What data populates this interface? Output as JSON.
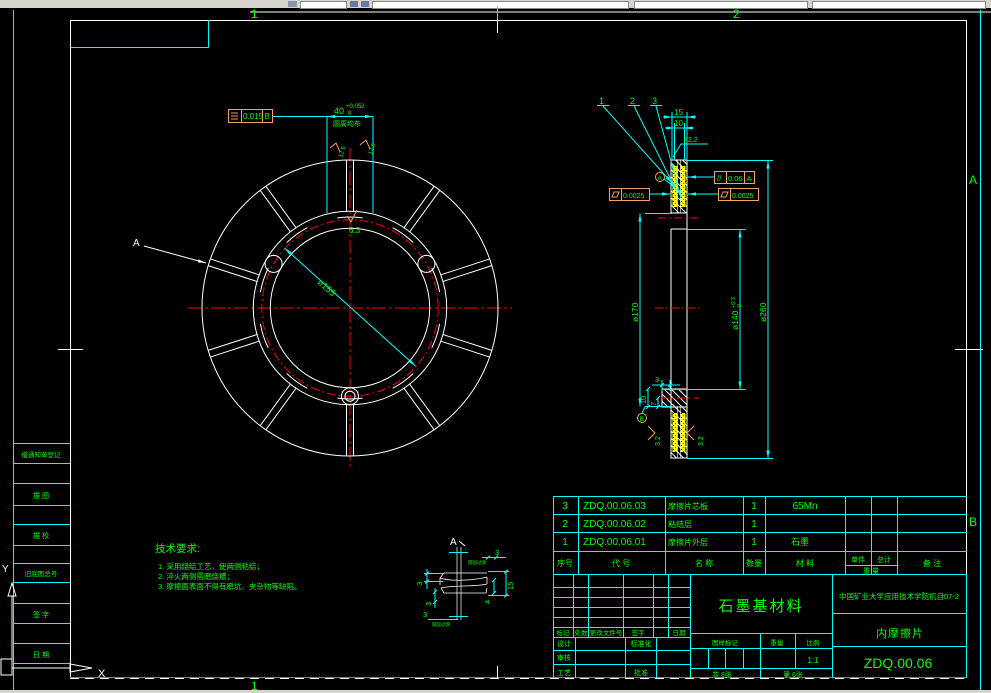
{
  "zones": {
    "top1": "1",
    "top2": "2",
    "bottom1": "1",
    "right_a": "A",
    "right_b": "B"
  },
  "left_strip": {
    "labels": [
      "借通知单登记",
      "描 图",
      "描 校",
      "旧底图总号",
      "签 字",
      "日 期"
    ]
  },
  "front_view": {
    "datum_arrow_label": "A",
    "fcf": {
      "symbol": "≡",
      "tolerance": "0.015",
      "datum": "B"
    },
    "width_dim": {
      "value": "40",
      "tol_upper": "+0.052",
      "tol_lower": "0",
      "note": "圆周均布"
    },
    "roughness_left": "12.5",
    "roughness_right": "12.5",
    "roughness_top": "6.3",
    "bore_dim": "ø155"
  },
  "side_view": {
    "leader_1": "1",
    "leader_2": "2",
    "leader_3": "3",
    "dim_15": "15",
    "dim_10": "10",
    "dim_42": "42.2",
    "fcf_parallelism": {
      "symbol": "//",
      "tolerance": "0.06",
      "datum": "A"
    },
    "fcf_flatness_left": "0.0025",
    "fcf_flatness_right": "0.0025",
    "datum_a": "A",
    "datum_b": "B",
    "dim_d170": "ø170",
    "dim_d140": "ø140",
    "dim_d140_tol_upper": "+0.3",
    "dim_d140_tol_lower": "0",
    "dim_d260": "ø260",
    "dim_tab_3": "3",
    "dim_tab_10": "10",
    "dim_tab_7": "7",
    "roughness_left": "3.2",
    "roughness_right": "3.2"
  },
  "detail_view": {
    "label": "A",
    "dim_top": "3",
    "note_top": "圆弧过渡",
    "dim_left": "3",
    "dim_bottom_left": "3",
    "dim_bottom": "3",
    "note_bottom": "圆弧过渡",
    "dim_15": "15",
    "dim_4": "4"
  },
  "tech_req": {
    "title": "技术要求:",
    "line1": "1. 采用烧结工艺，使两侧粘结；",
    "line2": "2. 淬火两侧需磨烧槽；",
    "line3": "3. 摩擦面表面不得有磨坑、夹杂物等缺陷。"
  },
  "parts_table": {
    "rows": [
      {
        "no": "3",
        "code": "ZDQ.00.06.03",
        "name": "摩擦片芯板",
        "qty": "1",
        "material": "65Mn"
      },
      {
        "no": "2",
        "code": "ZDQ.00.06.02",
        "name": "粘结层",
        "qty": "1",
        "material": ""
      },
      {
        "no": "1",
        "code": "ZDQ.00.06.01",
        "name": "摩擦片外层",
        "qty": "1",
        "material": "石墨"
      }
    ],
    "headers": {
      "no": "序号",
      "code": "代  号",
      "name": "名  称",
      "qty": "数量",
      "material": "材  料",
      "unit": "单件",
      "total": "总计",
      "weight": "重 量",
      "remark": "备  注"
    }
  },
  "title_block": {
    "rev_headers": {
      "mark": "标记",
      "count": "处数",
      "doc": "更改文件号",
      "sign": "签字",
      "date": "日期"
    },
    "sign_labels": {
      "design": "设计",
      "standard": "标准化",
      "check": "审核",
      "process": "工艺",
      "approve": "批准"
    },
    "title": "石墨基材料",
    "org": "中国矿业大学应用技术学院机自07-2",
    "part_name": "内摩擦片",
    "drawing_no": "ZDQ.00.06",
    "stamp_label": "图样标记",
    "weight_label": "重量",
    "scale_label": "比例",
    "scale_value": "1:1",
    "sheets": "共 8张",
    "sheet_no": "第 6张"
  }
}
